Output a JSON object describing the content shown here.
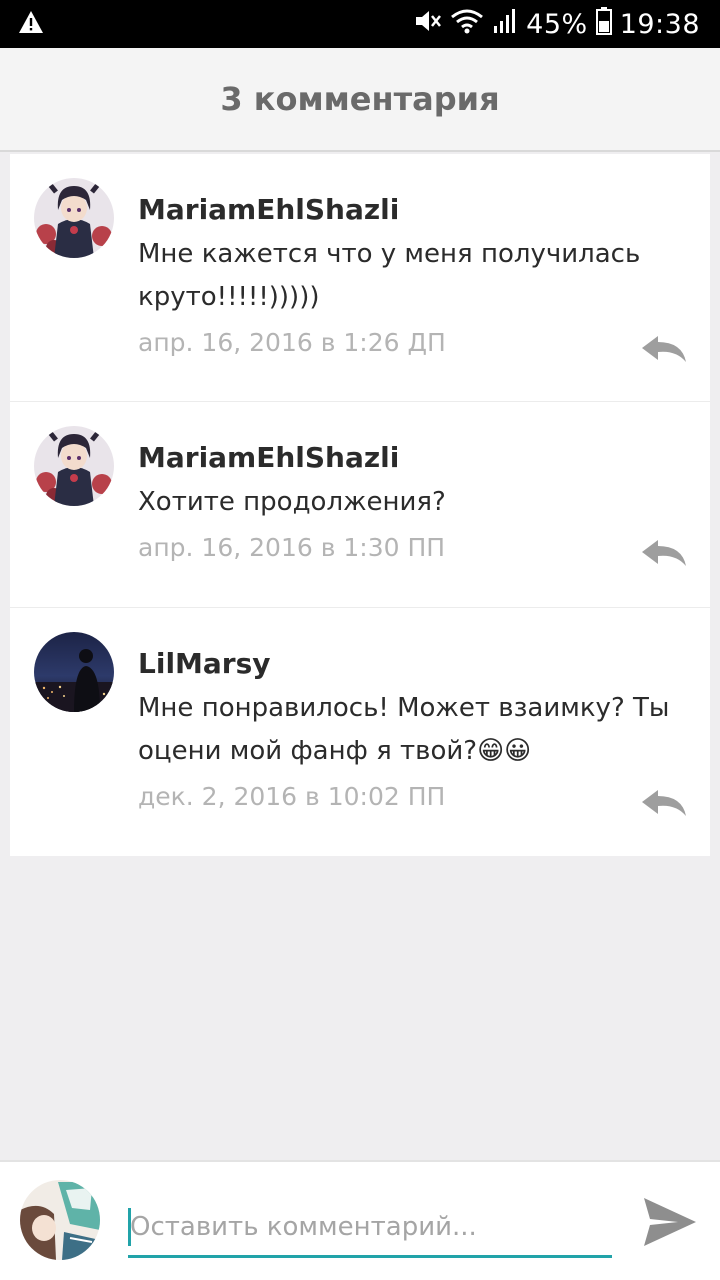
{
  "status_bar": {
    "battery": "45%",
    "time": "19:38",
    "icons": [
      "warning-icon",
      "mute-icon",
      "wifi-icon",
      "signal-icon",
      "battery-icon"
    ]
  },
  "header": {
    "title": "3 комментария"
  },
  "comments": [
    {
      "author": "MariamEhlShazli",
      "text": "Мне кажется что у меня получилась круто!!!!!)))))",
      "date": "апр. 16, 2016 в 1:26 ДП"
    },
    {
      "author": "MariamEhlShazli",
      "text": "Хотите продолжения?",
      "date": "апр. 16, 2016 в 1:30 ПП"
    },
    {
      "author": "LilMarsy",
      "text": "Мне понравилось! Может взаимку? Ты оцени мой фанф я твой?😁😀",
      "date": "дек. 2, 2016 в 10:02 ПП"
    }
  ],
  "compose": {
    "placeholder": "Оставить комментарий..."
  },
  "colors": {
    "accent": "#21a3a9",
    "icon_gray": "#9e9e9e",
    "background": "#efeef0"
  }
}
